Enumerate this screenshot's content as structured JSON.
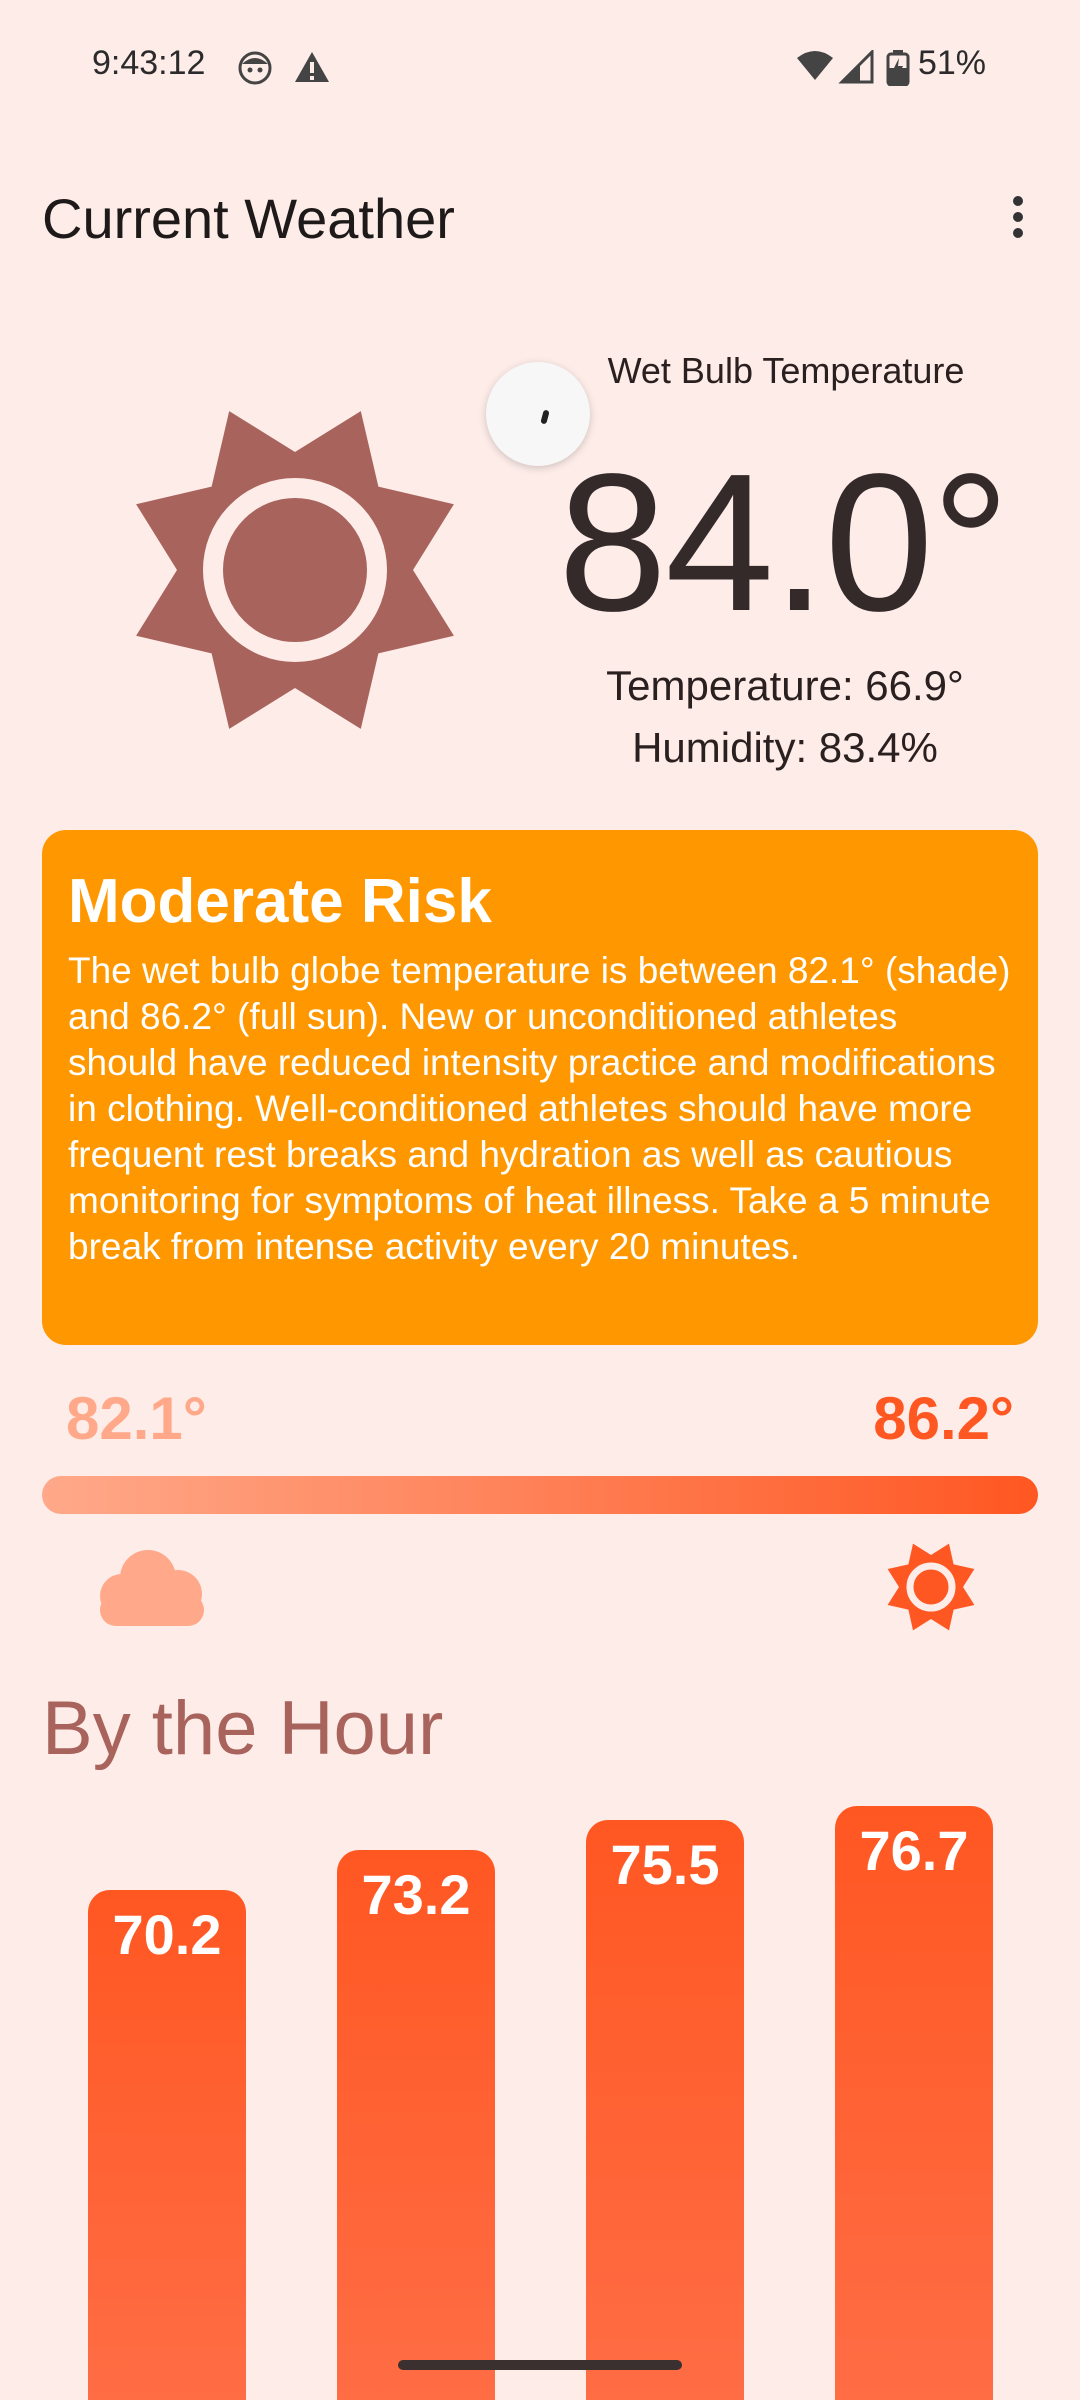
{
  "status_bar": {
    "time": "9:43:12",
    "battery": "51%",
    "icons": [
      "face-icon",
      "warning-icon",
      "wifi-icon",
      "signal-icon",
      "battery-icon"
    ]
  },
  "app_bar": {
    "title": "Current Weather",
    "menu_icon": "more-vert-icon"
  },
  "current": {
    "icon": "sun-icon",
    "wet_bulb_label": "Wet Bulb Temperature",
    "wet_bulb_value": "84.0°",
    "temperature": "Temperature: 66.9°",
    "humidity": "Humidity: 83.4%"
  },
  "risk": {
    "title": "Moderate Risk",
    "description": "The wet bulb globe temperature is between 82.1° (shade) and 86.2° (full sun). New or unconditioned athletes should have reduced intensity practice and modifications in clothing. Well-conditioned athletes should have more frequent rest breaks and hydration as well as cautious monitoring for symptoms of heat illness. Take a 5 minute break from intense activity every 20 minutes.",
    "color": "#FF9800"
  },
  "range": {
    "low": "82.1°",
    "high": "86.2°",
    "low_icon": "cloud-icon",
    "high_icon": "sun-icon",
    "low_color": "#FFA98A",
    "high_color": "#FF5722"
  },
  "hourly": {
    "heading": "By the Hour",
    "values": [
      "70.2",
      "73.2",
      "75.5",
      "76.7"
    ]
  },
  "colors": {
    "background": "#FDECE8",
    "sun": "#A8635C",
    "bar": "#FF5722"
  }
}
